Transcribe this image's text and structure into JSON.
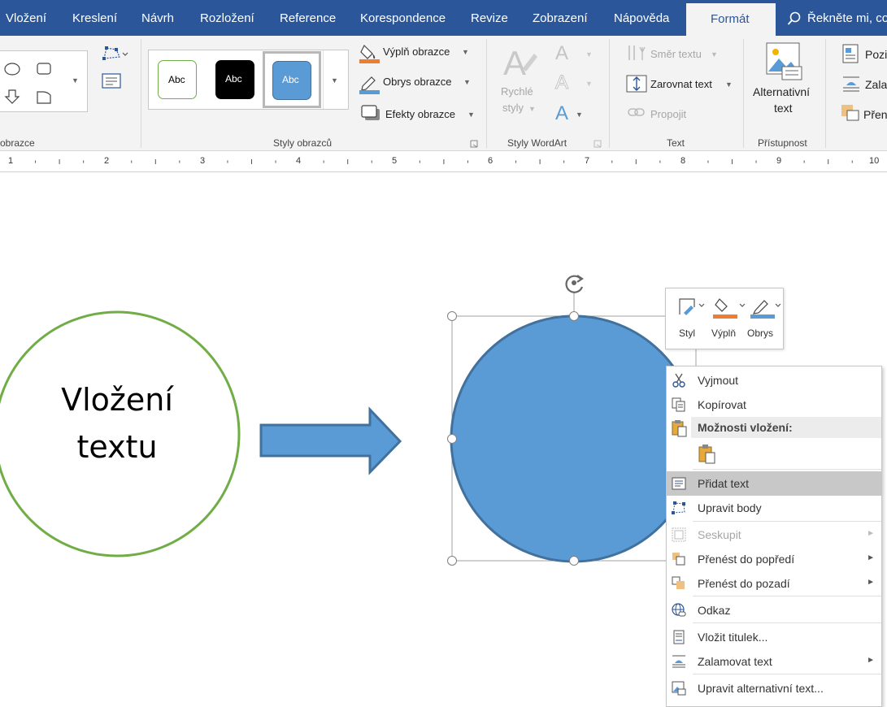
{
  "tabs": [
    "Vložení",
    "Kreslení",
    "Návrh",
    "Rozložení",
    "Reference",
    "Korespondence",
    "Revize",
    "Zobrazení",
    "Nápověda",
    "Formát"
  ],
  "tell_me": "Řekněte mi, co",
  "ribbon": {
    "insert_shapes_group": "obrazce",
    "styles": {
      "thumbs": [
        "Abc",
        "Abc",
        "Abc"
      ],
      "label": "Styly obrazců"
    },
    "fill": "Výplň obrazce",
    "outline": "Obrys obrazce",
    "effects": "Efekty obrazce",
    "wordart": {
      "quick_styles_1": "Rychlé",
      "quick_styles_2": "styly",
      "label": "Styly WordArt",
      "letter": "A"
    },
    "text_group": {
      "direction": "Směr textu",
      "align": "Zarovnat text",
      "link": "Propojit",
      "label": "Text"
    },
    "accessibility": {
      "alt_1": "Alternativní",
      "alt_2": "text",
      "label": "Přístupnost"
    },
    "arrange": {
      "position": "Pozi",
      "wrap": "Zala",
      "forward": "Přene"
    }
  },
  "ruler_numbers": [
    "1",
    "2",
    "3",
    "4",
    "5",
    "6",
    "7",
    "8",
    "9",
    "10"
  ],
  "canvas": {
    "circle_text_line1": "Vložení",
    "circle_text_line2": "textu"
  },
  "mini_toolbar": {
    "style": "Styl",
    "fill": "Výplň",
    "outline": "Obrys"
  },
  "context_menu": {
    "cut": "Vyjmout",
    "copy": "Kopírovat",
    "paste_header": "Možnosti vložení:",
    "add_text": "Přidat text",
    "edit_points": "Upravit body",
    "group": "Seskupit",
    "bring_forward": "Přenést do popředí",
    "send_backward": "Přenést do pozadí",
    "link": "Odkaz",
    "insert_caption": "Vložit titulek...",
    "wrap_text": "Zalamovat text",
    "edit_alt_text": "Upravit alternativní text..."
  },
  "colors": {
    "ribbon_blue": "#2b579a",
    "shape_fill": "#5b9bd5",
    "shape_stroke": "#41719c",
    "green_circle": "#70ad47",
    "fill_orange": "#ed7d31"
  }
}
